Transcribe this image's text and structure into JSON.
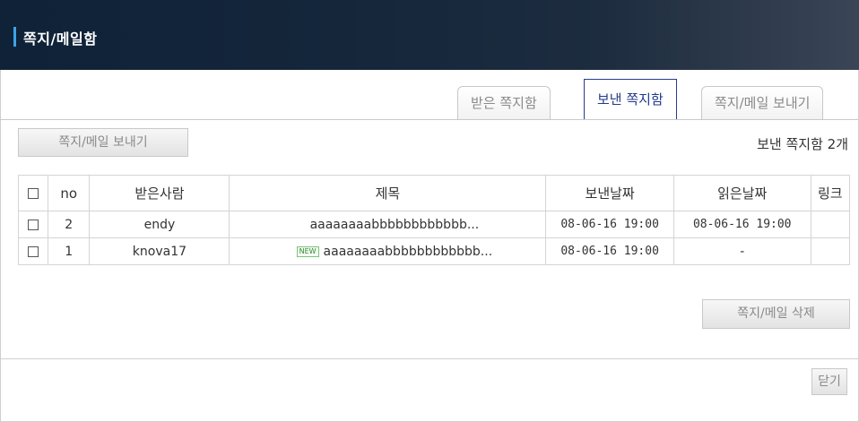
{
  "header": {
    "title": "쪽지/메일함"
  },
  "tabs": [
    {
      "label": "받은 쪽지함",
      "active": false
    },
    {
      "label": "보낸 쪽지함",
      "active": true
    },
    {
      "label": "쪽지/메일 보내기",
      "active": false
    }
  ],
  "toolbar": {
    "send_label": "쪽지/메일 보내기",
    "count_text": "보낸 쪽지함 2개"
  },
  "table": {
    "headers": [
      "",
      "no",
      "받은사람",
      "제목",
      "보낸날짜",
      "읽은날짜",
      "링크"
    ],
    "rows": [
      {
        "no": "2",
        "recipient": "endy",
        "subject": "aaaaaaaabbbbbbbbbbbb...",
        "is_new": false,
        "new_label": "",
        "sent": "08-06-16 19:00",
        "read": "08-06-16 19:00",
        "link": ""
      },
      {
        "no": "1",
        "recipient": "knova17",
        "subject": "aaaaaaaabbbbbbbbbbbb...",
        "is_new": true,
        "new_label": "NEW",
        "sent": "08-06-16 19:00",
        "read": "-",
        "link": ""
      }
    ]
  },
  "actions": {
    "delete_label": "쪽지/메일 삭제",
    "close_label": "닫기"
  },
  "colors": {
    "header_bg": "#15263b",
    "accent": "#3aa6e6",
    "active_tab_border": "#2a3a8c"
  }
}
